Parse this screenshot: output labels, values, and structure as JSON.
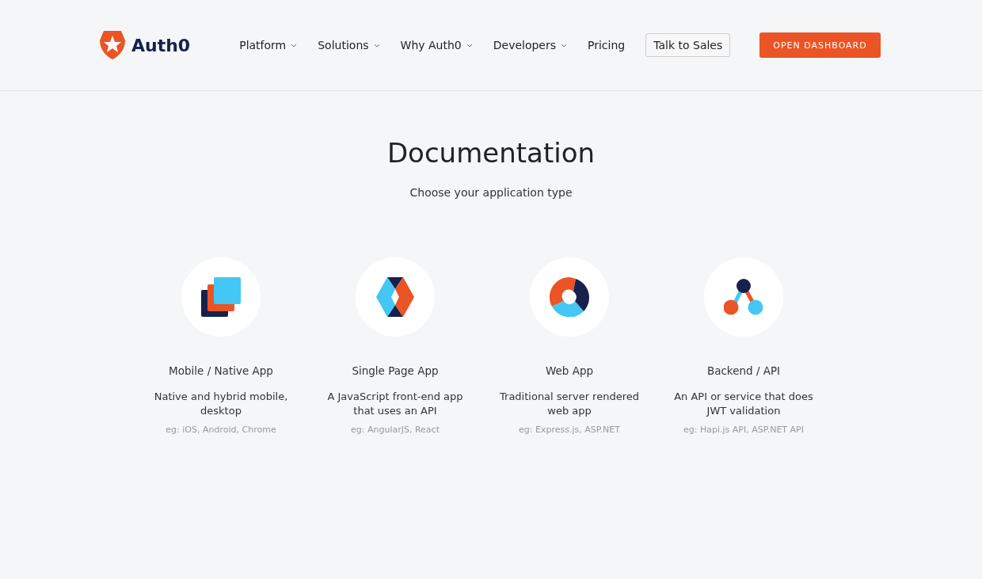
{
  "header": {
    "logo_text": "Auth0",
    "nav": [
      {
        "label": "Platform",
        "has_menu": true
      },
      {
        "label": "Solutions",
        "has_menu": true
      },
      {
        "label": "Why Auth0",
        "has_menu": true
      },
      {
        "label": "Developers",
        "has_menu": true
      },
      {
        "label": "Pricing",
        "has_menu": false
      }
    ],
    "sales_button": "Talk to Sales",
    "dashboard_button": "OPEN DASHBOARD"
  },
  "title": "Documentation",
  "subtitle": "Choose your application type",
  "app_types": [
    {
      "kind": "mobile",
      "name": "Mobile / Native App",
      "description": "Native and hybrid mobile, desktop",
      "examples": "eg: iOS, Android, Chrome"
    },
    {
      "kind": "spa",
      "name": "Single Page App",
      "description": "A JavaScript front-end app that uses an API",
      "examples": "eg: AngularJS, React"
    },
    {
      "kind": "web",
      "name": "Web App",
      "description": "Traditional server rendered web app",
      "examples": "eg: Express.js, ASP.NET"
    },
    {
      "kind": "backend",
      "name": "Backend / API",
      "description": "An API or service that does JWT validation",
      "examples": "eg: Hapi.js API, ASP.NET API"
    }
  ]
}
